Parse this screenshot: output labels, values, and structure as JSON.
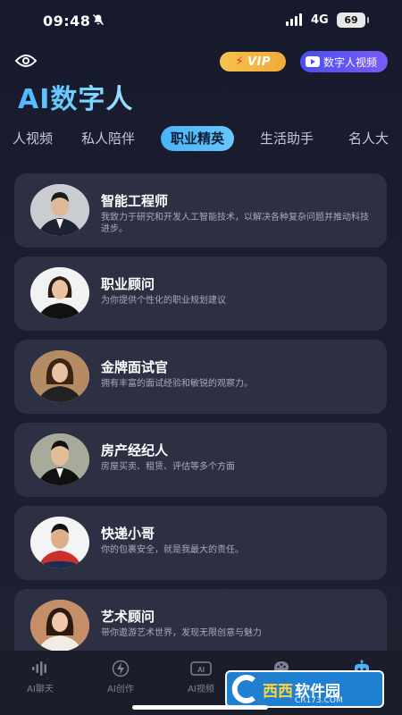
{
  "status_bar": {
    "time": "09:48",
    "network": "4G",
    "battery": "69"
  },
  "header": {
    "vip_label": "VIP",
    "digital_video_label": "数字人视频",
    "title": "AI数字人"
  },
  "tabs": [
    {
      "label": "人视频"
    },
    {
      "label": "私人陪伴"
    },
    {
      "label": "职业精英",
      "active": true
    },
    {
      "label": "生活助手"
    },
    {
      "label": "名人大"
    }
  ],
  "cards": [
    {
      "name": "智能工程师",
      "desc": "我致力于研究和开发人工智能技术，以解决各种复杂问题并推动科技进步。"
    },
    {
      "name": "职业顾问",
      "desc": "为你提供个性化的职业规划建议"
    },
    {
      "name": "金牌面试官",
      "desc": "拥有丰富的面试经验和敏锐的观察力。"
    },
    {
      "name": "房产经纪人",
      "desc": "房屋买卖、租赁、评估等多个方面"
    },
    {
      "name": "快递小哥",
      "desc": "你的包裹安全，就是我最大的责任。"
    },
    {
      "name": "艺术顾问",
      "desc": "带你遨游艺术世界，发现无限创意与魅力"
    }
  ],
  "bottom_nav": [
    {
      "label": "AI聊天",
      "icon": "voice-wave-icon"
    },
    {
      "label": "AI创作",
      "icon": "bolt-icon"
    },
    {
      "label": "AI视频",
      "icon": "ai-video-icon"
    },
    {
      "label": "",
      "icon": "palette-icon"
    },
    {
      "label": "",
      "icon": "robot-icon"
    }
  ],
  "watermark": {
    "brand": "西西",
    "text": "软件园",
    "url": "CR173.COM"
  },
  "colors": {
    "accent": "#4ab3f7",
    "card_bg": "#2d3042",
    "vip": "#f6c24e",
    "video_btn": "#5a52f2"
  }
}
